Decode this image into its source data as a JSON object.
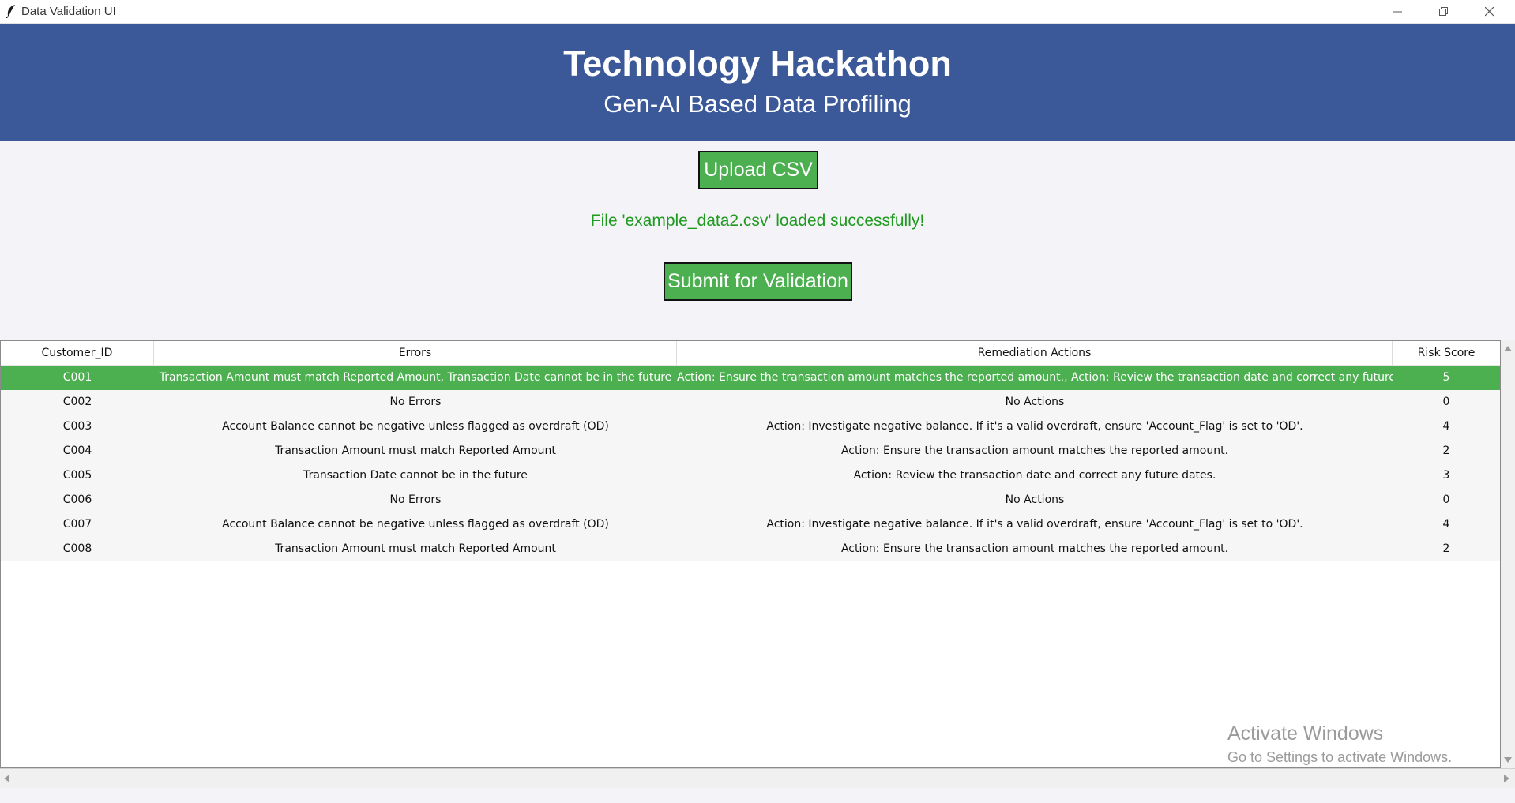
{
  "window": {
    "title": "Data Validation UI"
  },
  "header": {
    "title": "Technology Hackathon",
    "subtitle": "Gen-AI Based Data Profiling"
  },
  "controls": {
    "upload_label": "Upload CSV",
    "status_text": "File 'example_data2.csv' loaded successfully!",
    "submit_label": "Submit for Validation"
  },
  "colors": {
    "banner": "#3b5998",
    "button": "#4caf50",
    "status": "#1f9a1f",
    "selected_row": "#4caf50"
  },
  "table": {
    "columns": [
      "Customer_ID",
      "Errors",
      "Remediation Actions",
      "Risk Score"
    ],
    "selected_row": 0,
    "rows": [
      {
        "id": "C001",
        "errors": "Transaction Amount must match Reported Amount, Transaction Date cannot be in the future",
        "actions": "Action: Ensure the transaction amount matches the reported amount., Action: Review the transaction date and correct any future dates.",
        "risk": "5"
      },
      {
        "id": "C002",
        "errors": "No Errors",
        "actions": "No Actions",
        "risk": "0"
      },
      {
        "id": "C003",
        "errors": "Account Balance cannot be negative unless flagged as overdraft (OD)",
        "actions": "Action: Investigate negative balance. If it's a valid overdraft, ensure 'Account_Flag' is set to 'OD'.",
        "risk": "4"
      },
      {
        "id": "C004",
        "errors": "Transaction Amount must match Reported Amount",
        "actions": "Action: Ensure the transaction amount matches the reported amount.",
        "risk": "2"
      },
      {
        "id": "C005",
        "errors": "Transaction Date cannot be in the future",
        "actions": "Action: Review the transaction date and correct any future dates.",
        "risk": "3"
      },
      {
        "id": "C006",
        "errors": "No Errors",
        "actions": "No Actions",
        "risk": "0"
      },
      {
        "id": "C007",
        "errors": "Account Balance cannot be negative unless flagged as overdraft (OD)",
        "actions": "Action: Investigate negative balance. If it's a valid overdraft, ensure 'Account_Flag' is set to 'OD'.",
        "risk": "4"
      },
      {
        "id": "C008",
        "errors": "Transaction Amount must match Reported Amount",
        "actions": "Action: Ensure the transaction amount matches the reported amount.",
        "risk": "2"
      }
    ]
  },
  "watermark": {
    "line1": "Activate Windows",
    "line2": "Go to Settings to activate Windows."
  }
}
